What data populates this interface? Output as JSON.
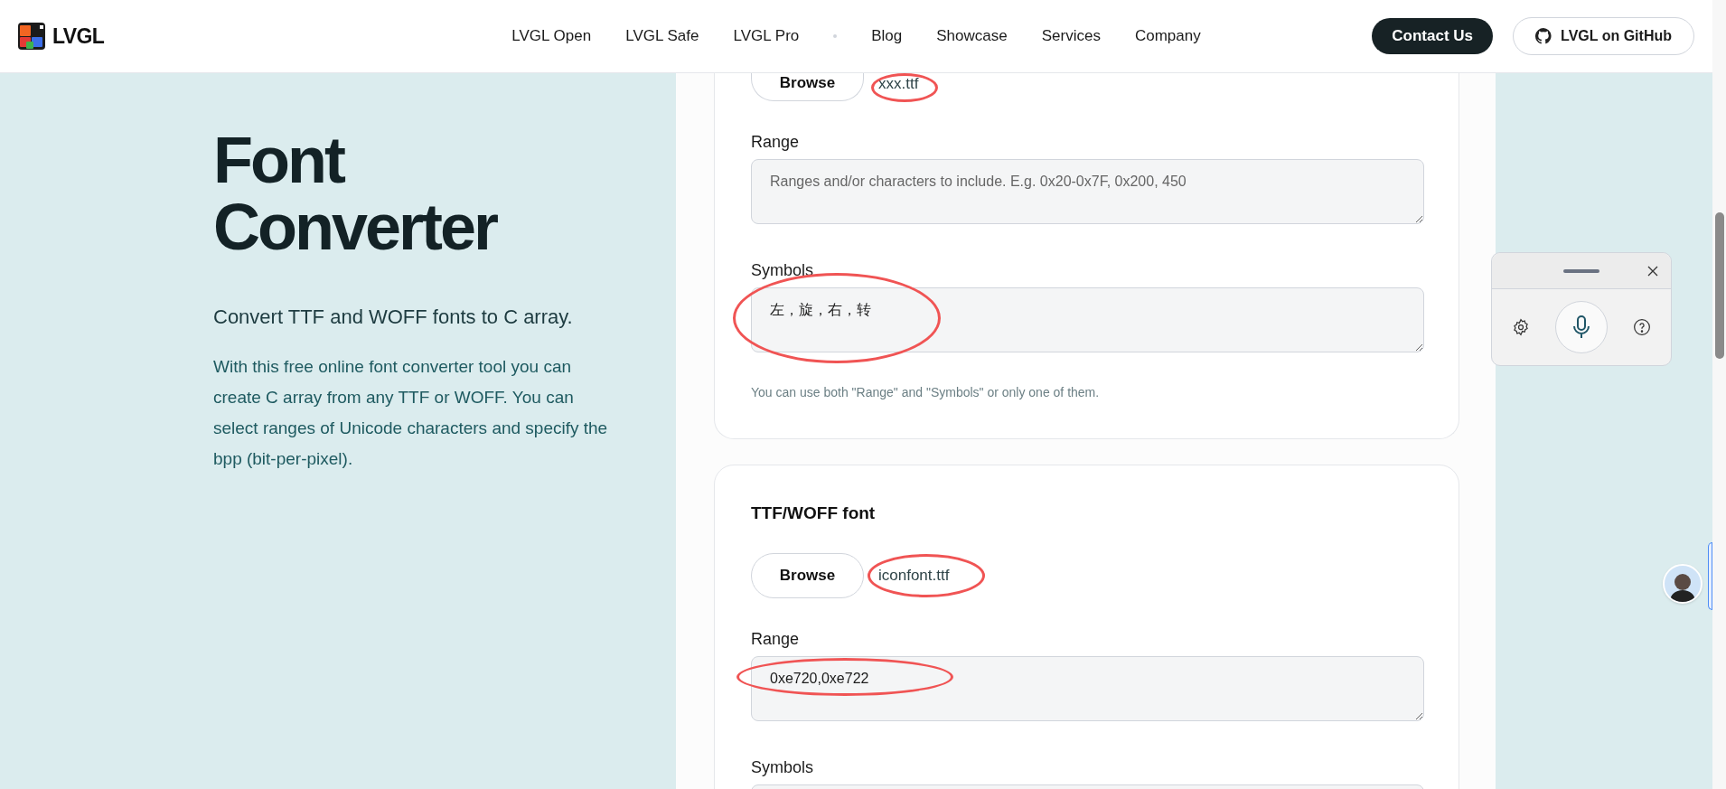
{
  "header": {
    "logo_text": "LVGL",
    "nav": [
      {
        "kind": "link",
        "label": "LVGL Open"
      },
      {
        "kind": "link",
        "label": "LVGL Safe"
      },
      {
        "kind": "link",
        "label": "LVGL Pro"
      },
      {
        "kind": "separator"
      },
      {
        "kind": "link",
        "label": "Blog"
      },
      {
        "kind": "link",
        "label": "Showcase"
      },
      {
        "kind": "link",
        "label": "Services"
      },
      {
        "kind": "link",
        "label": "Company"
      }
    ],
    "contact_button": "Contact Us",
    "github_button": "LVGL on GitHub"
  },
  "intro": {
    "title": "Font Converter",
    "subtitle": "Convert TTF and WOFF fonts to C array.",
    "description": "With this free online font converter tool you can create C array from any TTF or WOFF. You can select ranges of Unicode characters and specify the bpp (bit-per-pixel)."
  },
  "cards": [
    {
      "browse_button": "Browse",
      "file_name": "xxx.ttf",
      "file_highlighted": true,
      "range": {
        "label": "Range",
        "placeholder": "Ranges and/or characters to include. E.g. 0x20-0x7F, 0x200, 450",
        "highlighted": false
      },
      "symbols": {
        "label": "Symbols",
        "value": "左，旋，右，转",
        "highlighted": true
      },
      "hint": "You can use both \"Range\" and \"Symbols\" or only one of them."
    },
    {
      "heading": "TTF/WOFF font",
      "browse_button": "Browse",
      "file_name": "iconfont.ttf",
      "file_highlighted": true,
      "range": {
        "label": "Range",
        "value": "0xe720,0xe722",
        "highlighted": true
      },
      "symbols": {
        "label": "Symbols",
        "highlighted": false
      }
    }
  ]
}
